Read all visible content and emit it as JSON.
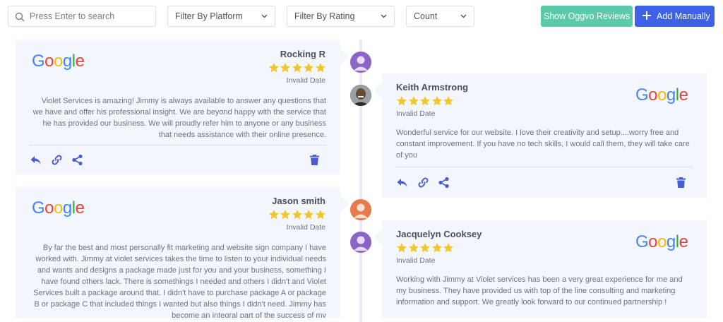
{
  "search": {
    "placeholder": "Press Enter to search"
  },
  "filters": {
    "platform": "Filter By Platform",
    "rating": "Filter By Rating",
    "count": "Count"
  },
  "buttons": {
    "oggvo": "Show Oggvo Reviews",
    "add": "Add Manually"
  },
  "colors": {
    "primary": "#3d62e8",
    "teal": "#5ccaa9",
    "star": "#f6c52b",
    "icon": "#4a5dcc",
    "avatar_purple": "#8b64c8",
    "avatar_orange": "#e8794a"
  },
  "platform_logo": {
    "b1": "G",
    "r1": "o",
    "y1": "o",
    "b2": "g",
    "g1": "l",
    "r2": "e"
  },
  "reviews": [
    {
      "name": "Rocking R",
      "rating": 5,
      "date": "Invalid Date",
      "text": "Violet Services is amazing! Jimmy is always available to answer any questions that we have and offer his professional insight. We are beyond happy with the service that he has provided our business. We will proudly refer him to anyone or any business that needs assistance with their online presence."
    },
    {
      "name": "Keith Armstrong",
      "rating": 5,
      "date": "Invalid Date",
      "text": "Wonderful service for our website. I love their creativity and setup....worry free and constant improvement. If you have no tech skills, I would call them, they will take care of you"
    },
    {
      "name": "Jason smith",
      "rating": 5,
      "date": "Invalid Date",
      "text": "By far the best and most personally fit marketing and website sign company I have worked with. Jimmy at violet services takes the time to listen to your individual needs and wants and designs a package made just for you and your business, something I have found others lack. There is somethings I needed and others I didn't and Violet Services built a package around that. I didn't have to purchase package A or package B or package C that included things I wanted but also things I didn't need. Jimmy has become an integral part of the success of my"
    },
    {
      "name": "Jacquelyn Cooksey",
      "rating": 5,
      "date": "Invalid Date",
      "text": "Working with Jimmy at Violet services has been a very great experience for me and my business. They have provided us with top of the line consulting and marketing information and support. We greatly look forward to our continued partnership !"
    }
  ]
}
